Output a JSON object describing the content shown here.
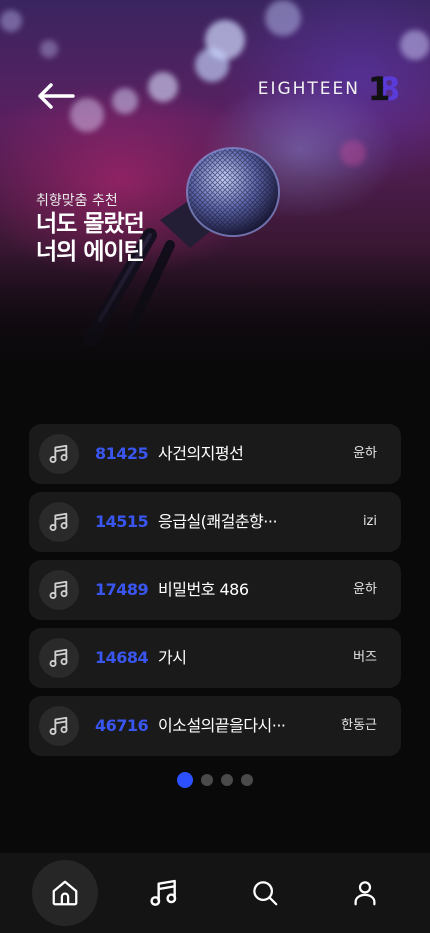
{
  "header": {
    "brand_text": "EIGHTEEN",
    "logo_text_one": "1",
    "logo_text_eight": "8"
  },
  "hero": {
    "subtitle": "취향맞춤 추천",
    "title_line1": "너도 몰랐던",
    "title_line2": "너의 에이틴"
  },
  "songs": [
    {
      "number": "81425",
      "title": "사건의지평선",
      "artist": "윤하"
    },
    {
      "number": "14515",
      "title": "응급실(쾌걸춘향···",
      "artist": "izi"
    },
    {
      "number": "17489",
      "title": "비밀번호 486",
      "artist": "윤하"
    },
    {
      "number": "14684",
      "title": "가시",
      "artist": "버즈"
    },
    {
      "number": "46716",
      "title": "이소설의끝을다시···",
      "artist": "한동근"
    }
  ],
  "pagination": {
    "total": 4,
    "active_index": 0
  },
  "nav": [
    "home-icon",
    "music-note-icon",
    "search-icon",
    "user-icon"
  ],
  "colors": {
    "accent": "#2c50ff",
    "number": "#3a56f0",
    "row_bg": "#1a1a1a",
    "background": "#090909"
  }
}
